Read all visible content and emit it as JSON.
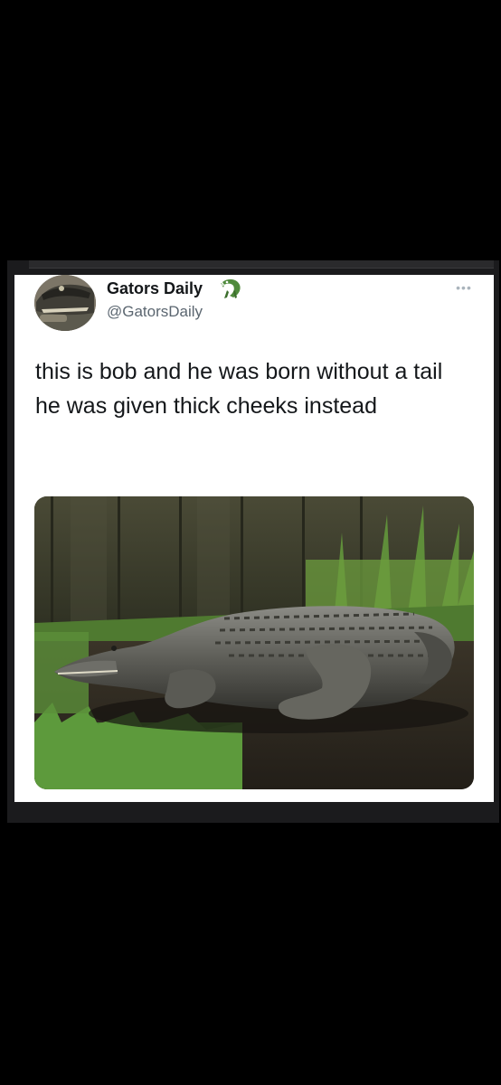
{
  "tweet": {
    "display_name": "Gators Daily",
    "name_emoji": "crocodile-emoji",
    "handle": "@GatorsDaily",
    "more_icon": "more-dots-icon",
    "text_lines": [
      "this is bob and he was born without a tail",
      "he was given thick cheeks instead"
    ],
    "media": {
      "subject": "alligator-photo"
    }
  },
  "colors": {
    "page_background": "#000000",
    "card_background": "#ffffff",
    "text_primary": "#14171a",
    "text_secondary": "#5b6670",
    "emoji_green": "#4f8a3c"
  }
}
